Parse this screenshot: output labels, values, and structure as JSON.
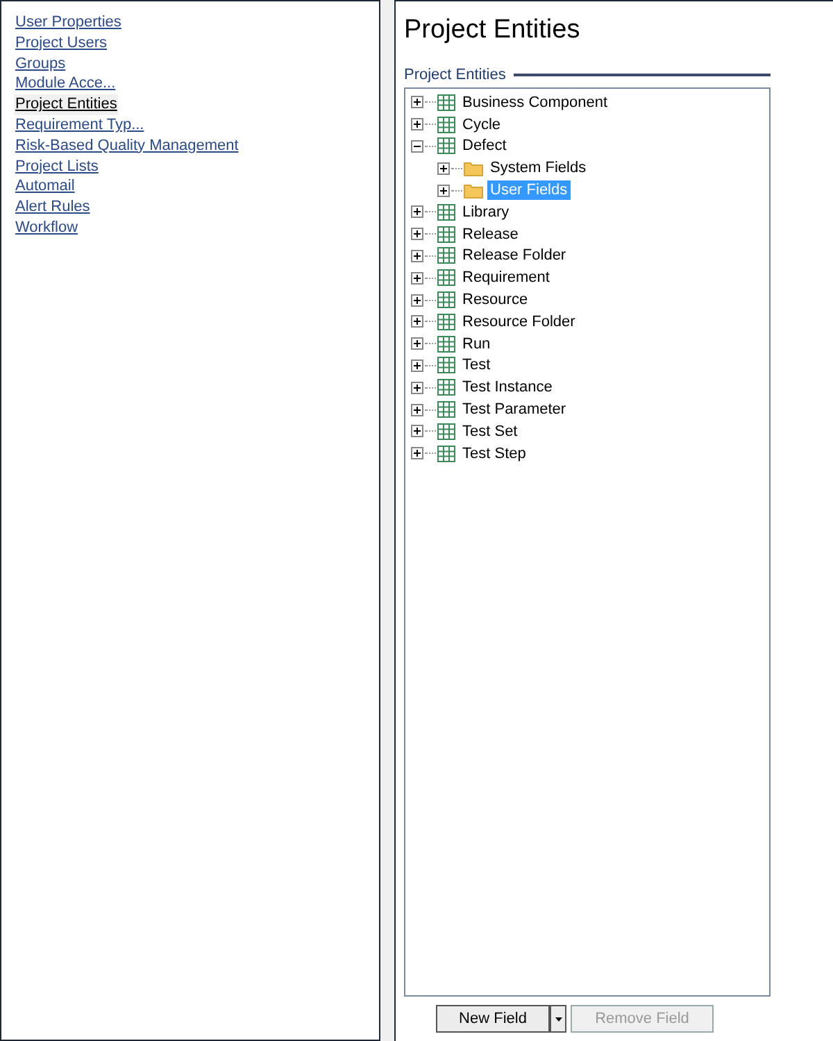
{
  "sidebar": {
    "items": [
      {
        "label": "User Properties",
        "selected": false
      },
      {
        "label": "Project Users",
        "selected": false
      },
      {
        "label": "Groups",
        "selected": false
      },
      {
        "label": "Module Acce...",
        "selected": false
      },
      {
        "label": "Project Entities",
        "selected": true
      },
      {
        "label": "Requirement Typ...",
        "selected": false
      },
      {
        "label": "Risk-Based Quality Management",
        "selected": false
      },
      {
        "label": "Project Lists",
        "selected": false
      },
      {
        "label": "Automail",
        "selected": false
      },
      {
        "label": "Alert Rules",
        "selected": false
      },
      {
        "label": "Workflow",
        "selected": false
      }
    ]
  },
  "title": "Project Entities",
  "group_label": "Project Entities",
  "tree": [
    {
      "label": "Business Component",
      "kind": "entity",
      "expanded": false,
      "selected": false
    },
    {
      "label": "Cycle",
      "kind": "entity",
      "expanded": false,
      "selected": false
    },
    {
      "label": "Defect",
      "kind": "entity",
      "expanded": true,
      "selected": false,
      "children": [
        {
          "label": "System Fields",
          "kind": "folder",
          "expanded": false,
          "selected": false
        },
        {
          "label": "User Fields",
          "kind": "folder",
          "expanded": false,
          "selected": true
        }
      ]
    },
    {
      "label": "Library",
      "kind": "entity",
      "expanded": false,
      "selected": false
    },
    {
      "label": "Release",
      "kind": "entity",
      "expanded": false,
      "selected": false
    },
    {
      "label": "Release Folder",
      "kind": "entity",
      "expanded": false,
      "selected": false
    },
    {
      "label": "Requirement",
      "kind": "entity",
      "expanded": false,
      "selected": false
    },
    {
      "label": "Resource",
      "kind": "entity",
      "expanded": false,
      "selected": false
    },
    {
      "label": "Resource Folder",
      "kind": "entity",
      "expanded": false,
      "selected": false
    },
    {
      "label": "Run",
      "kind": "entity",
      "expanded": false,
      "selected": false
    },
    {
      "label": "Test",
      "kind": "entity",
      "expanded": false,
      "selected": false
    },
    {
      "label": "Test Instance",
      "kind": "entity",
      "expanded": false,
      "selected": false
    },
    {
      "label": "Test Parameter",
      "kind": "entity",
      "expanded": false,
      "selected": false
    },
    {
      "label": "Test Set",
      "kind": "entity",
      "expanded": false,
      "selected": false
    },
    {
      "label": "Test Step",
      "kind": "entity",
      "expanded": false,
      "selected": false
    }
  ],
  "buttons": [
    {
      "label": "New Field",
      "disabled": false
    },
    {
      "label": "Remove Field",
      "disabled": true
    }
  ]
}
